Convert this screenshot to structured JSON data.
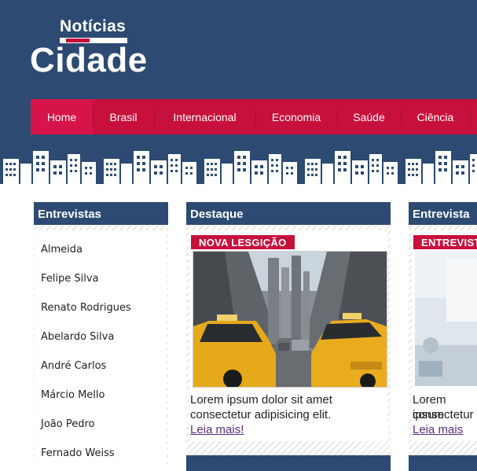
{
  "logo": {
    "top": "Notícias",
    "main": "Cidade"
  },
  "nav": {
    "items": [
      {
        "label": "Home",
        "active": true
      },
      {
        "label": "Brasil"
      },
      {
        "label": "Internacional"
      },
      {
        "label": "Economia"
      },
      {
        "label": "Saúde"
      },
      {
        "label": "Ciência"
      }
    ]
  },
  "interviews": {
    "title": "Entrevistas",
    "items": [
      "Almeida",
      "Felipe Silva",
      "Renato Rodrigues",
      "Abelardo Silva",
      "André Carlos",
      "Márcio Mello",
      "João Pedro",
      "Fernado Weiss"
    ]
  },
  "featured": {
    "title": "Destaque",
    "tag": "NOVA LESGIÇÃO",
    "caption_line1": "Lorem ipsum dolor sit amet",
    "caption_line2": "consectetur adipisicing elit.",
    "more": "Leia mais!"
  },
  "interview": {
    "title": "Entrevista",
    "tag": "ENTREVISTA",
    "caption_line1": "Lorem ipsum",
    "caption_line2": "consectetur",
    "more": "Leia mais"
  },
  "colors": {
    "navy": "#2c4a72",
    "crimson": "#c8103d",
    "link": "#5a2a7a"
  }
}
